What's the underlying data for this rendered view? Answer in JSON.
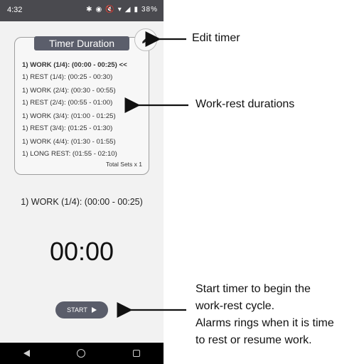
{
  "status_bar": {
    "time": "4:32",
    "battery": "38%"
  },
  "card": {
    "title": "Timer Duration",
    "intervals": [
      {
        "label": "1) WORK (1/4): (00:00 - 00:25) <<",
        "current": true
      },
      {
        "label": "1) REST (1/4): (00:25 - 00:30)"
      },
      {
        "label": "1) WORK (2/4): (00:30 - 00:55)"
      },
      {
        "label": "1) REST (2/4): (00:55 - 01:00)"
      },
      {
        "label": "1) WORK (3/4): (01:00 - 01:25)"
      },
      {
        "label": "1) REST (3/4): (01:25 - 01:30)"
      },
      {
        "label": "1) WORK (4/4): (01:30 - 01:55)"
      },
      {
        "label": "1) LONG REST: (01:55 - 02:10)"
      }
    ],
    "total_sets": "Total Sets x 1"
  },
  "current_interval": "1) WORK (1/4): (00:00 - 00:25)",
  "timer_display": "00:00",
  "start_button": {
    "label": "START"
  },
  "annotations": {
    "edit_timer": "Edit timer",
    "work_rest": "Work-rest durations",
    "start_line1": "Start timer to begin the",
    "start_line2": "work-rest cycle.",
    "start_line3": "Alarms rings when it is time",
    "start_line4": "to rest or resume work."
  },
  "icons": {
    "edit": "pencil-icon",
    "play": "play-icon",
    "nav_back": "back-icon",
    "nav_home": "home-icon",
    "nav_recent": "recent-apps-icon"
  }
}
